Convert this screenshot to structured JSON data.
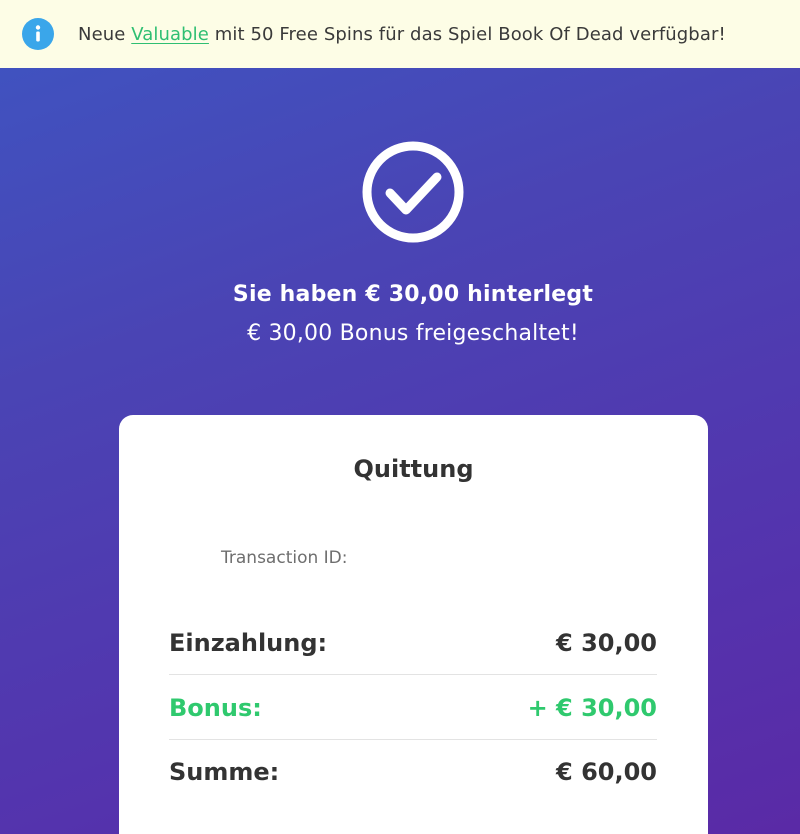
{
  "notice": {
    "prefix": "Neue ",
    "link": "Valuable",
    "suffix": " mit 50 Free Spins für das Spiel Book Of Dead verfügbar!",
    "icon": "info-icon",
    "icon_color": "#3aa6ea",
    "link_color": "#2fbf72"
  },
  "success": {
    "icon": "check-circle-icon",
    "headline": "Sie haben € 30,00 hinterlegt",
    "subline": "€ 30,00 Bonus freigeschaltet!"
  },
  "receipt": {
    "title": "Quittung",
    "transaction_label": "Transaction ID:",
    "rows": [
      {
        "label": "Einzahlung:",
        "value": "€ 30,00"
      },
      {
        "label": "Bonus:",
        "value": "+ € 30,00",
        "color": "#2fc96e"
      },
      {
        "label": "Summe:",
        "value": "€ 60,00"
      }
    ]
  }
}
